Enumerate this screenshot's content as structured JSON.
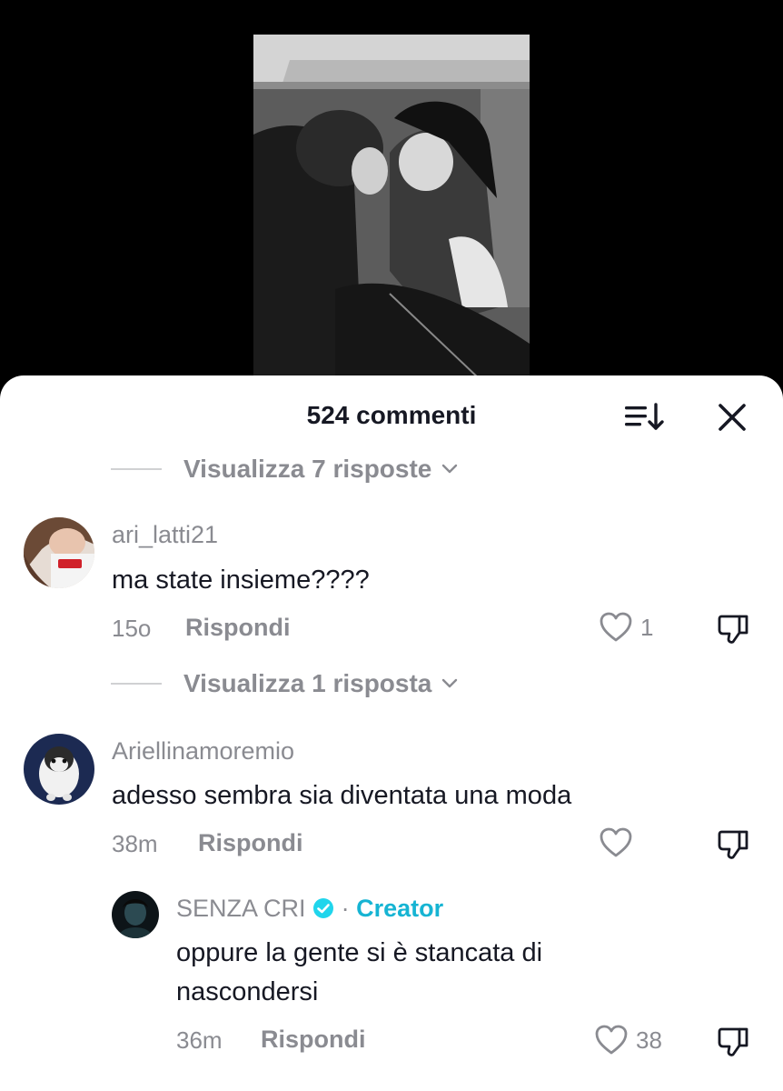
{
  "sheet": {
    "title": "524 commenti"
  },
  "threads": [
    {
      "view_replies_label": "Visualizza 7 risposte"
    },
    {
      "view_replies_label": "Visualizza 1 risposta"
    }
  ],
  "comments": [
    {
      "username": "ari_latti21",
      "text": "ma state insieme????",
      "time": "15o",
      "reply_label": "Rispondi",
      "likes": "1"
    },
    {
      "username": "Ariellinamoremio",
      "text": "adesso sembra sia diventata una moda",
      "time": "38m",
      "reply_label": "Rispondi",
      "likes": ""
    },
    {
      "username": "SENZA CRI",
      "creator_separator": "·",
      "creator_label": "Creator",
      "text_line1": "oppure la gente si è stancata di",
      "text_line2": "nascondersi",
      "time": "36m",
      "reply_label": "Rispondi",
      "likes": "38"
    }
  ],
  "colors": {
    "accent_creator": "#16b4d3",
    "secondary_text": "#8a8b91",
    "primary_text": "#161823"
  },
  "icons": {
    "sort": "sort-icon",
    "close": "close-icon",
    "chevron": "chevron-down-icon",
    "like": "heart-icon",
    "dislike": "thumbs-down-icon",
    "verified": "verified-badge-icon"
  }
}
